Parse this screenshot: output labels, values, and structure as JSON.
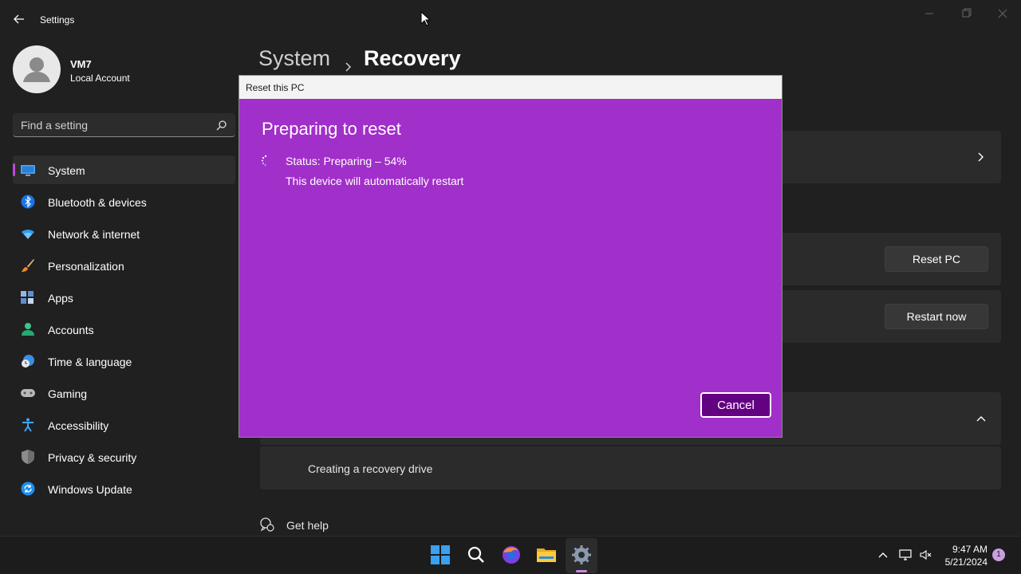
{
  "window": {
    "app_title": "Settings"
  },
  "account": {
    "name": "VM7",
    "type": "Local Account"
  },
  "search": {
    "placeholder": "Find a setting"
  },
  "sidebar": {
    "items": [
      {
        "label": "System",
        "icon": "monitor-icon",
        "selected": true
      },
      {
        "label": "Bluetooth & devices",
        "icon": "bluetooth-icon"
      },
      {
        "label": "Network & internet",
        "icon": "wifi-icon"
      },
      {
        "label": "Personalization",
        "icon": "brush-icon"
      },
      {
        "label": "Apps",
        "icon": "apps-icon"
      },
      {
        "label": "Accounts",
        "icon": "person-icon"
      },
      {
        "label": "Time & language",
        "icon": "clock-globe-icon"
      },
      {
        "label": "Gaming",
        "icon": "gamepad-icon"
      },
      {
        "label": "Accessibility",
        "icon": "accessibility-icon"
      },
      {
        "label": "Privacy & security",
        "icon": "shield-icon"
      },
      {
        "label": "Windows Update",
        "icon": "update-icon"
      }
    ]
  },
  "breadcrumb": {
    "parent": "System",
    "current": "Recovery"
  },
  "main": {
    "reset_button": "Reset PC",
    "restart_button": "Restart now",
    "recovery_drive": "Creating a recovery drive",
    "get_help": "Get help"
  },
  "dialog": {
    "title": "Reset this PC",
    "heading": "Preparing to reset",
    "status": "Status: Preparing – 54%",
    "note": "This device will automatically restart",
    "cancel_label": "Cancel",
    "progress_percent": 54
  },
  "taskbar": {
    "time": "9:47 AM",
    "date": "5/21/2024",
    "notification_count": "1"
  },
  "colors": {
    "dialog_bg": "#a12fc9",
    "accent": "#b84ad6",
    "background": "#202020"
  }
}
